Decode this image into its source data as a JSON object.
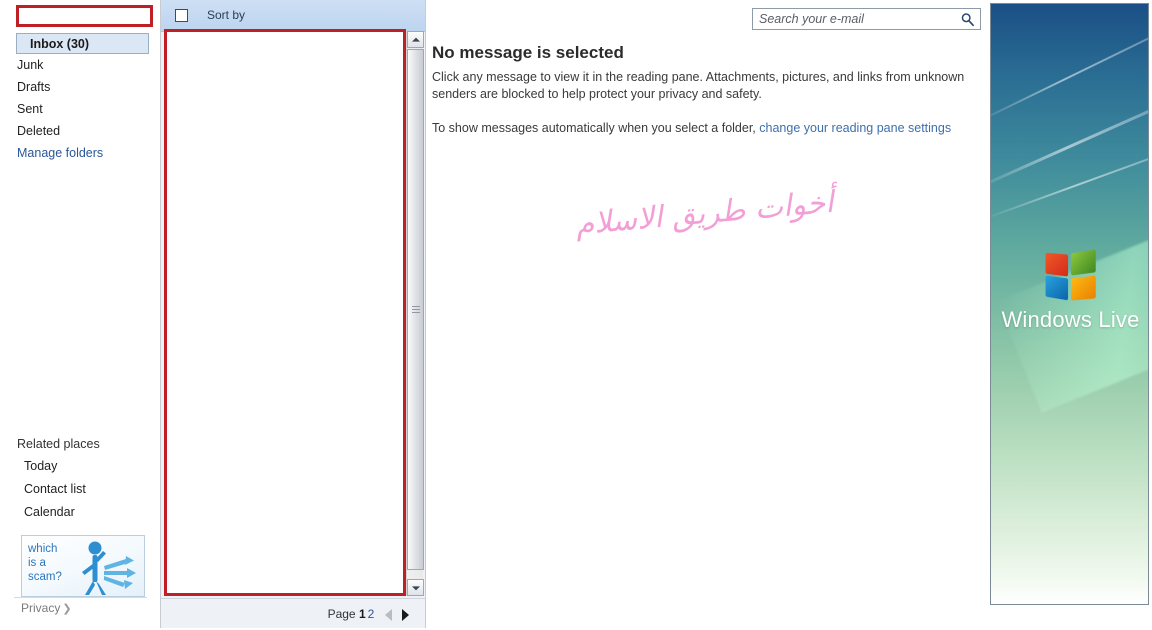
{
  "sidebar": {
    "account_box_value": "",
    "folders": [
      {
        "label": "Inbox (30)",
        "selected": true
      },
      {
        "label": "Junk",
        "selected": false
      },
      {
        "label": "Drafts",
        "selected": false
      },
      {
        "label": "Sent",
        "selected": false
      },
      {
        "label": "Deleted",
        "selected": false
      }
    ],
    "manage_folders_label": "Manage folders",
    "related_places_label": "Related places",
    "related_items": [
      {
        "label": "Today"
      },
      {
        "label": "Contact list"
      },
      {
        "label": "Calendar"
      }
    ],
    "ad": {
      "line1": "which",
      "line2": "is a",
      "line3": "scam?"
    },
    "privacy_label": "Privacy",
    "privacy_chevron": "❯"
  },
  "message_list": {
    "toolbar": {
      "sort_by_label": "Sort by"
    },
    "items": [],
    "pager": {
      "page_label": "Page",
      "current_page": "1",
      "other_page": "2"
    }
  },
  "reading_pane": {
    "search": {
      "placeholder": "Search your e-mail",
      "value": ""
    },
    "title": "No message is selected",
    "body": "Click any message to view it in the reading pane. Attachments, pictures, and links from unknown senders are blocked to help protect your privacy and safety.",
    "note_prefix": "To show messages automatically when you select a folder, ",
    "note_link": "change your reading pane settings",
    "watermark": "أخوات طريق الاسلام"
  },
  "right_panel": {
    "brand_text": "Windows Live"
  },
  "colors": {
    "annotation_red": "#bf2026",
    "toolbar_blue": "#cddff4",
    "link_blue": "#2b5797",
    "selected_item_bg": "#dbe7f5",
    "watermark_pink": "#f08fd0"
  }
}
